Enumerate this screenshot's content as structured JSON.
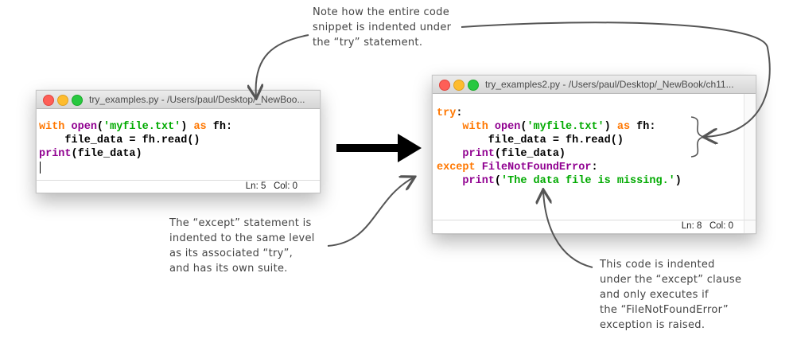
{
  "left_window": {
    "title": "try_examples.py - /Users/paul/Desktop/_NewBoo...",
    "code_lines": [
      [
        {
          "t": "with",
          "c": "kw"
        },
        {
          "t": " "
        },
        {
          "t": "open",
          "c": "bi"
        },
        {
          "t": "("
        },
        {
          "t": "'myfile.txt'",
          "c": "st"
        },
        {
          "t": ") "
        },
        {
          "t": "as",
          "c": "kw"
        },
        {
          "t": " fh:"
        }
      ],
      [
        {
          "t": "    file_data = fh.read()"
        }
      ],
      [
        {
          "t": "print",
          "c": "bi"
        },
        {
          "t": "(file_data)"
        }
      ]
    ],
    "status": "Ln: 5   Col: 0"
  },
  "right_window": {
    "title": "try_examples2.py - /Users/paul/Desktop/_NewBook/ch11...",
    "code_lines": [
      [
        {
          "t": "try",
          "c": "kw"
        },
        {
          "t": ":"
        }
      ],
      [
        {
          "t": "    "
        },
        {
          "t": "with",
          "c": "kw"
        },
        {
          "t": " "
        },
        {
          "t": "open",
          "c": "bi"
        },
        {
          "t": "("
        },
        {
          "t": "'myfile.txt'",
          "c": "st"
        },
        {
          "t": ") "
        },
        {
          "t": "as",
          "c": "kw"
        },
        {
          "t": " fh:"
        }
      ],
      [
        {
          "t": "        file_data = fh.read()"
        }
      ],
      [
        {
          "t": "    "
        },
        {
          "t": "print",
          "c": "bi"
        },
        {
          "t": "(file_data)"
        }
      ],
      [
        {
          "t": "except",
          "c": "kw"
        },
        {
          "t": " "
        },
        {
          "t": "FileNotFoundError",
          "c": "bi"
        },
        {
          "t": ":"
        }
      ],
      [
        {
          "t": "    "
        },
        {
          "t": "print",
          "c": "bi"
        },
        {
          "t": "("
        },
        {
          "t": "'The data file is missing.'",
          "c": "st"
        },
        {
          "t": ")"
        }
      ]
    ],
    "status": "Ln: 8   Col: 0"
  },
  "annotations": {
    "top": "Note how the entire code\nsnippet is indented under\nthe “try” statement.",
    "left": "The “except” statement is\nindented to the same level\nas its associated “try”,\nand has its own suite.",
    "right": "This code is indented\nunder the “except” clause\nand only executes if\nthe “FileNotFoundError”\nexception is raised."
  }
}
